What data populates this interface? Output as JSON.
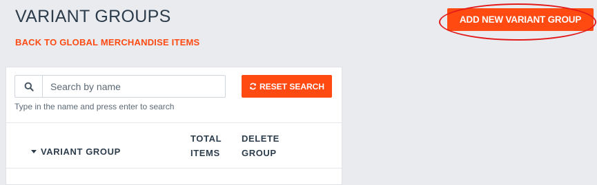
{
  "header": {
    "title": "VARIANT GROUPS",
    "back_link": "BACK TO GLOBAL MERCHANDISE ITEMS",
    "add_button": "ADD NEW VARIANT GROUP"
  },
  "search": {
    "placeholder": "Search by name",
    "value": "",
    "help_text": "Type in the name and press enter to search",
    "reset_label": "RESET SEARCH",
    "icon": "search-icon"
  },
  "table": {
    "columns": {
      "group": "VARIANT GROUP",
      "total_line1": "TOTAL",
      "total_line2": "ITEMS",
      "delete_line1": "DELETE",
      "delete_line2": "GROUP"
    },
    "sort": {
      "column": "group",
      "direction": "descending"
    }
  },
  "colors": {
    "accent": "#ff4a12",
    "heading": "#2d3c4b",
    "background": "#e9ebef",
    "annotation": "#e21a1a"
  }
}
